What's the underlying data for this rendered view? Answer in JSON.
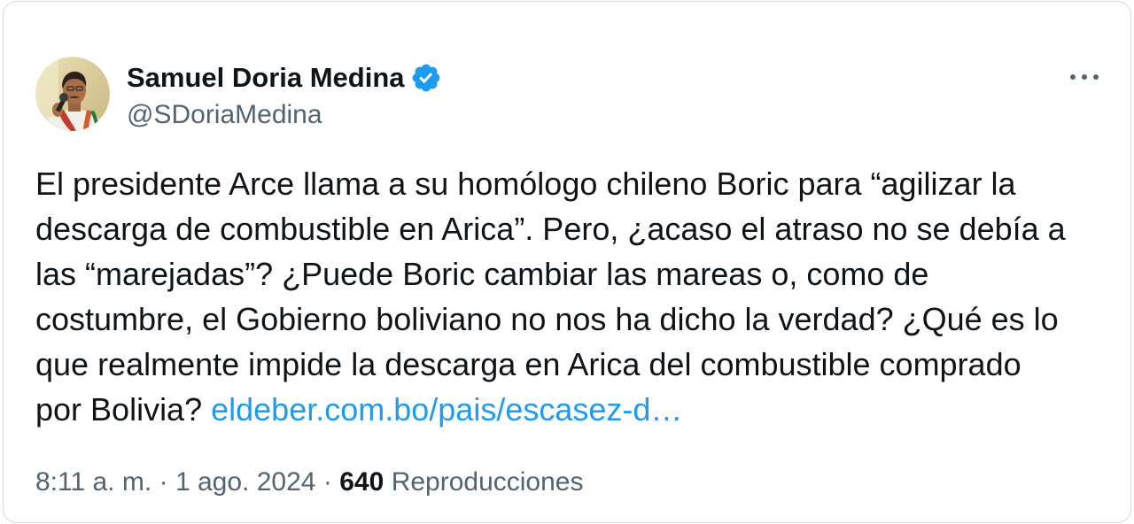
{
  "author": {
    "name": "Samuel Doria Medina",
    "handle": "@SDoriaMedina",
    "verified": true,
    "avatar_icon": "profile-photo",
    "badge_icon": "verified-badge-icon"
  },
  "actions": {
    "more_icon": "more-options-icon"
  },
  "tweet": {
    "lines": [
      "El presidente Arce llama a su homólogo chileno Boric para “agilizar la",
      "descarga de combustible en Arica”. Pero, ¿acaso el atraso no se debía a",
      "las “marejadas”? ¿Puede Boric cambiar las mareas o, como de",
      "costumbre, el Gobierno boliviano no nos ha dicho la verdad? ¿Qué es lo",
      "que realmente impide la descarga en Arica del combustible comprado"
    ],
    "last_line_text": "por Bolivia? ",
    "link_text": "eldeber.com.bo/pais/escasez-d…"
  },
  "meta": {
    "time": "8:11 a. m.",
    "separator": "·",
    "date": "1 ago. 2024",
    "views_count": "640",
    "views_label": "Reproducciones"
  },
  "colors": {
    "accent": "#1d9bf0",
    "text_primary": "#0f1419",
    "text_secondary": "#536471",
    "border": "#cfd9de"
  }
}
